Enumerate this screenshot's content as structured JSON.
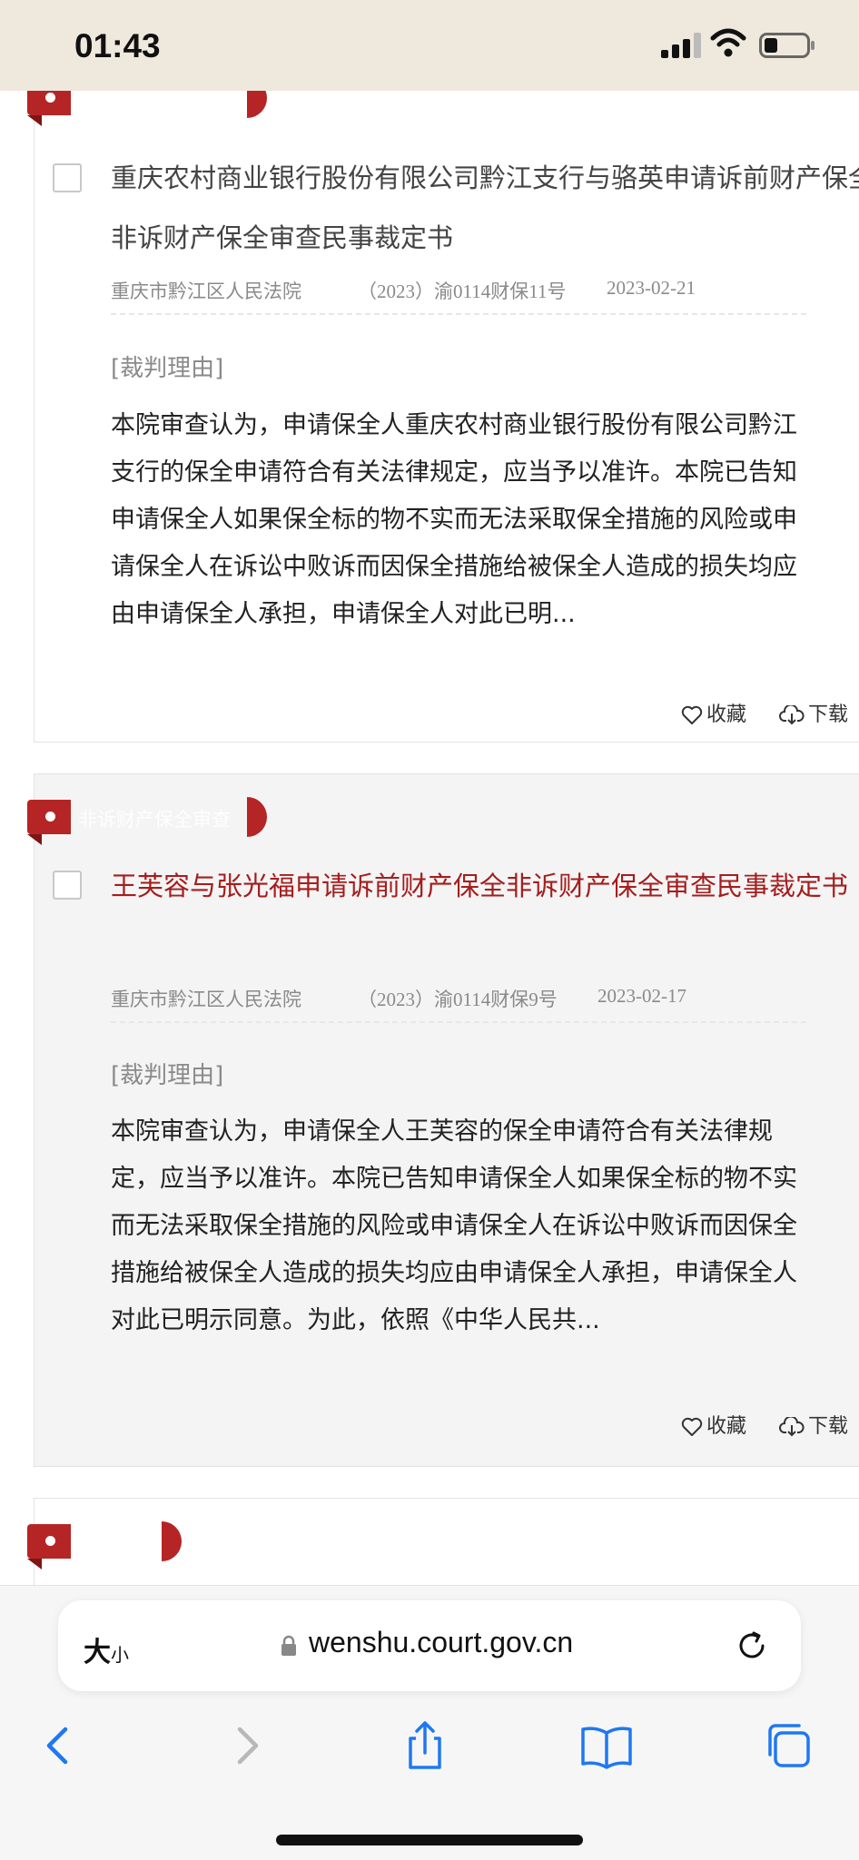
{
  "status_bar": {
    "time": "01:43"
  },
  "cards": [
    {
      "tag": "",
      "title": "重庆农村商业银行股份有限公司黔江支行与骆英申请诉前财产保全非诉财产保全审查民事裁定书",
      "court": "重庆市黔江区人民法院",
      "case_no": "（2023）渝0114财保11号",
      "date": "2023-02-21",
      "reason_label": "[裁判理由]",
      "summary": "本院审查认为，申请保全人重庆农村商业银行股份有限公司黔江支行的保全申请符合有关法律规定，应当予以准许。本院已告知申请保全人如果保全标的物不实而无法采取保全措施的风险或申请保全人在诉讼中败诉而因保全措施给被保全人造成的损失均应由申请保全人承担，申请保全人对此已明...",
      "favorite_label": "收藏",
      "download_label": "下载"
    },
    {
      "tag": "非诉财产保全审查",
      "title": "王芙容与张光福申请诉前财产保全非诉财产保全审查民事裁定书",
      "court": "重庆市黔江区人民法院",
      "case_no": "（2023）渝0114财保9号",
      "date": "2023-02-17",
      "reason_label": "[裁判理由]",
      "summary": "本院审查认为，申请保全人王芙容的保全申请符合有关法律规定，应当予以准许。本院已告知申请保全人如果保全标的物不实而无法采取保全措施的风险或申请保全人在诉讼中败诉而因保全措施给被保全人造成的损失均应由申请保全人承担，申请保全人对此已明示同意。为此，依照《中华人民共...",
      "favorite_label": "收藏",
      "download_label": "下载"
    }
  ],
  "browser": {
    "text_size_big": "大",
    "text_size_small": "小",
    "url": "wenshu.court.gov.cn"
  },
  "colors": {
    "ribbon": "#b52525",
    "active_title": "#a51d1d",
    "status_bar_bg": "#efe8dd",
    "ios_blue": "#1f78f2"
  }
}
